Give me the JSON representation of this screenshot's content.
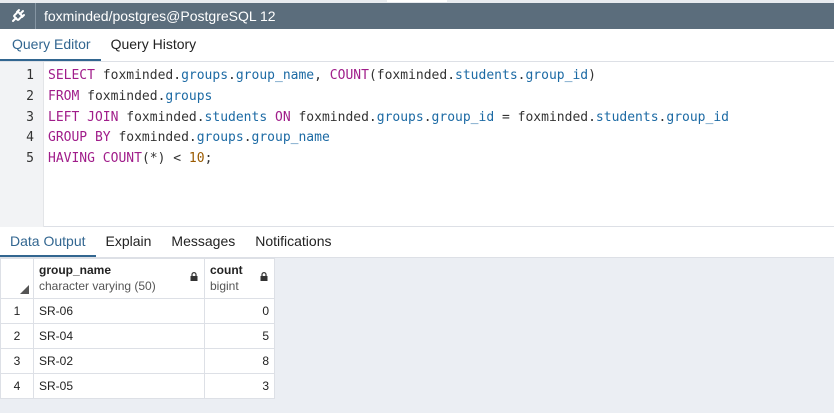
{
  "window": {
    "title": "foxminded/postgres@PostgreSQL 12",
    "conn_icon": "connection-plug-icon"
  },
  "editor_tabs": [
    {
      "label": "Query Editor",
      "active": true
    },
    {
      "label": "Query History",
      "active": false
    }
  ],
  "editor": {
    "line_numbers": [
      "1",
      "2",
      "3",
      "4",
      "5"
    ],
    "lines": [
      [
        {
          "t": "SELECT",
          "k": "kw"
        },
        {
          "t": " foxminded.",
          "k": "id"
        },
        {
          "t": "groups",
          "k": "fld"
        },
        {
          "t": ".",
          "k": "id"
        },
        {
          "t": "group_name",
          "k": "fld"
        },
        {
          "t": ", ",
          "k": "id"
        },
        {
          "t": "COUNT",
          "k": "kw"
        },
        {
          "t": "(foxminded.",
          "k": "id"
        },
        {
          "t": "students",
          "k": "fld"
        },
        {
          "t": ".",
          "k": "id"
        },
        {
          "t": "group_id",
          "k": "fld"
        },
        {
          "t": ")",
          "k": "id"
        }
      ],
      [
        {
          "t": "FROM",
          "k": "kw"
        },
        {
          "t": " foxminded.",
          "k": "id"
        },
        {
          "t": "groups",
          "k": "fld"
        }
      ],
      [
        {
          "t": "LEFT JOIN",
          "k": "kw"
        },
        {
          "t": " foxminded.",
          "k": "id"
        },
        {
          "t": "students",
          "k": "fld"
        },
        {
          "t": " ",
          "k": "id"
        },
        {
          "t": "ON",
          "k": "kw"
        },
        {
          "t": " foxminded.",
          "k": "id"
        },
        {
          "t": "groups",
          "k": "fld"
        },
        {
          "t": ".",
          "k": "id"
        },
        {
          "t": "group_id",
          "k": "fld"
        },
        {
          "t": " = foxminded.",
          "k": "id"
        },
        {
          "t": "students",
          "k": "fld"
        },
        {
          "t": ".",
          "k": "id"
        },
        {
          "t": "group_id",
          "k": "fld"
        }
      ],
      [
        {
          "t": "GROUP BY",
          "k": "kw"
        },
        {
          "t": " foxminded.",
          "k": "id"
        },
        {
          "t": "groups",
          "k": "fld"
        },
        {
          "t": ".",
          "k": "id"
        },
        {
          "t": "group_name",
          "k": "fld"
        }
      ],
      [
        {
          "t": "HAVING",
          "k": "kw"
        },
        {
          "t": " ",
          "k": "id"
        },
        {
          "t": "COUNT",
          "k": "kw"
        },
        {
          "t": "(*) < ",
          "k": "op"
        },
        {
          "t": "10",
          "k": "num"
        },
        {
          "t": ";",
          "k": "id"
        }
      ]
    ]
  },
  "output_tabs": [
    {
      "label": "Data Output",
      "active": true
    },
    {
      "label": "Explain",
      "active": false
    },
    {
      "label": "Messages",
      "active": false
    },
    {
      "label": "Notifications",
      "active": false
    }
  ],
  "grid": {
    "columns": [
      {
        "name": "group_name",
        "type": "character varying (50)",
        "icon": "lock-icon"
      },
      {
        "name": "count",
        "type": "bigint",
        "icon": "lock-icon"
      }
    ],
    "rows": [
      {
        "n": "1",
        "group_name": "SR-06",
        "count": "0"
      },
      {
        "n": "2",
        "group_name": "SR-04",
        "count": "5"
      },
      {
        "n": "3",
        "group_name": "SR-02",
        "count": "8"
      },
      {
        "n": "4",
        "group_name": "SR-05",
        "count": "3"
      }
    ]
  }
}
